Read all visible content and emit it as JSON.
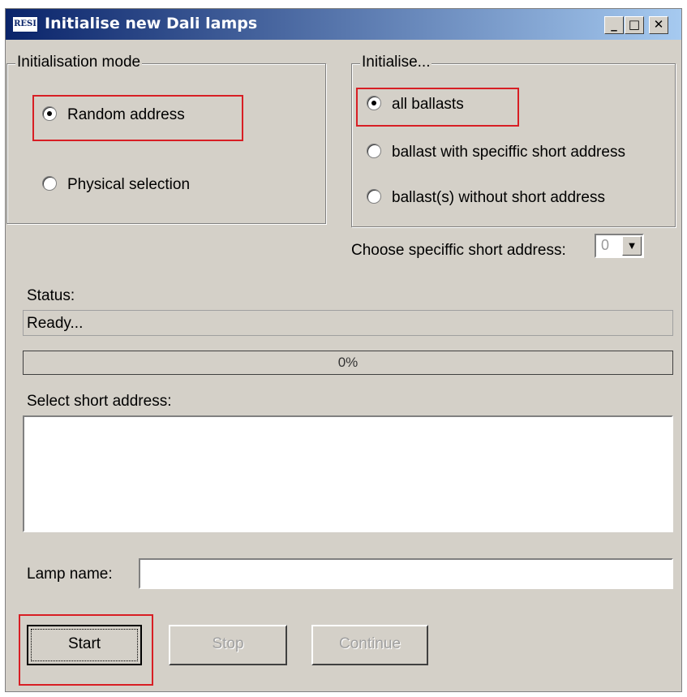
{
  "window": {
    "icon_text": "RESI",
    "title": "Initialise new Dali lamps",
    "controls": {
      "minimize": "_",
      "maximize": "□",
      "close": "✕"
    }
  },
  "init_mode": {
    "title": "Initialisation mode",
    "options": [
      {
        "label": "Random address",
        "selected": true
      },
      {
        "label": "Physical selection",
        "selected": false
      }
    ]
  },
  "initialise": {
    "title": "Initialise...",
    "options": [
      {
        "label": "all ballasts",
        "selected": true
      },
      {
        "label": "ballast with speciffic short address",
        "selected": false
      },
      {
        "label": "ballast(s) without short address",
        "selected": false
      }
    ]
  },
  "short_address": {
    "label": "Choose speciffic short address:",
    "value": "0",
    "arrow": "▼"
  },
  "status": {
    "label": "Status:",
    "text": "Ready..."
  },
  "progress": {
    "text": "0%",
    "value": 0
  },
  "select_short_address": {
    "label": "Select short address:"
  },
  "lamp_name": {
    "label": "Lamp name:",
    "value": ""
  },
  "buttons": {
    "start": "Start",
    "stop": "Stop",
    "continue": "Continue"
  },
  "colors": {
    "highlight": "#d81e24",
    "title_start": "#0a246a",
    "title_end": "#a6caf0",
    "face": "#d4d0c8"
  }
}
